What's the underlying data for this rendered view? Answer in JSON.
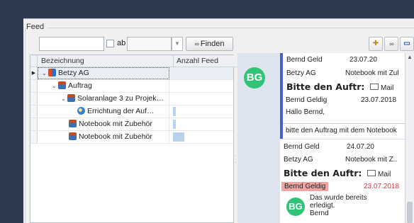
{
  "panel": {
    "legend": "Feed"
  },
  "filter": {
    "search_value": "",
    "ab_label": "ab",
    "combo_value": "",
    "find_label": "Finden",
    "binoculars_glyph": "∞"
  },
  "grid": {
    "columns": [
      "Bezeichnung",
      "Anzahl Feed"
    ],
    "rows": [
      {
        "label": "Betzy AG",
        "icon": "group-icon",
        "count_fraction": 0
      },
      {
        "label": "Auftrag",
        "icon": "document-icon",
        "count_fraction": 0
      },
      {
        "label": "Solaranlage 3 zu Projek…",
        "icon": "document-icon",
        "count_fraction": 0
      },
      {
        "label": "Errichtung der Auf…",
        "icon": "globe-icon",
        "count_fraction": 0.05
      },
      {
        "label": "Notebook mit Zubehör",
        "icon": "document-icon",
        "count_fraction": 0.05
      },
      {
        "label": "Notebook mit Zubehör",
        "icon": "document-icon",
        "count_fraction": 0.2
      }
    ]
  },
  "feed": {
    "avatar_initials": "BG",
    "card1": {
      "author": "Bernd Geld",
      "date": "23.07.20",
      "company": "Betzy AG",
      "subject_short": "Notebook mit Zul",
      "title": "Bitte den Auftr:",
      "type": "Mail",
      "sender": "Bernd Geldig",
      "sender_date": "23.07.2018",
      "greeting": "Hallo Bernd,",
      "body": "bitte den Auftrag mit dem Notebook"
    },
    "card2": {
      "author": "Bernd Geld",
      "date": "24.07.20",
      "company": "Betzy AG",
      "subject_short": "Notebook mit Z..",
      "title": "Bitte den Auftr:",
      "type": "Mail",
      "sender": "Bernd Geldig",
      "sender_date": "23.07.2018",
      "reply_line1": "Das wurde bereits",
      "reply_line2": "erledigt.",
      "reply_line3": "Bernd",
      "reply_initials": "BG"
    }
  },
  "colors": {
    "accent": "#4a60c8",
    "avatar": "#2fc476",
    "alert": "#e2323a",
    "highlight": "#f0a4a4"
  }
}
